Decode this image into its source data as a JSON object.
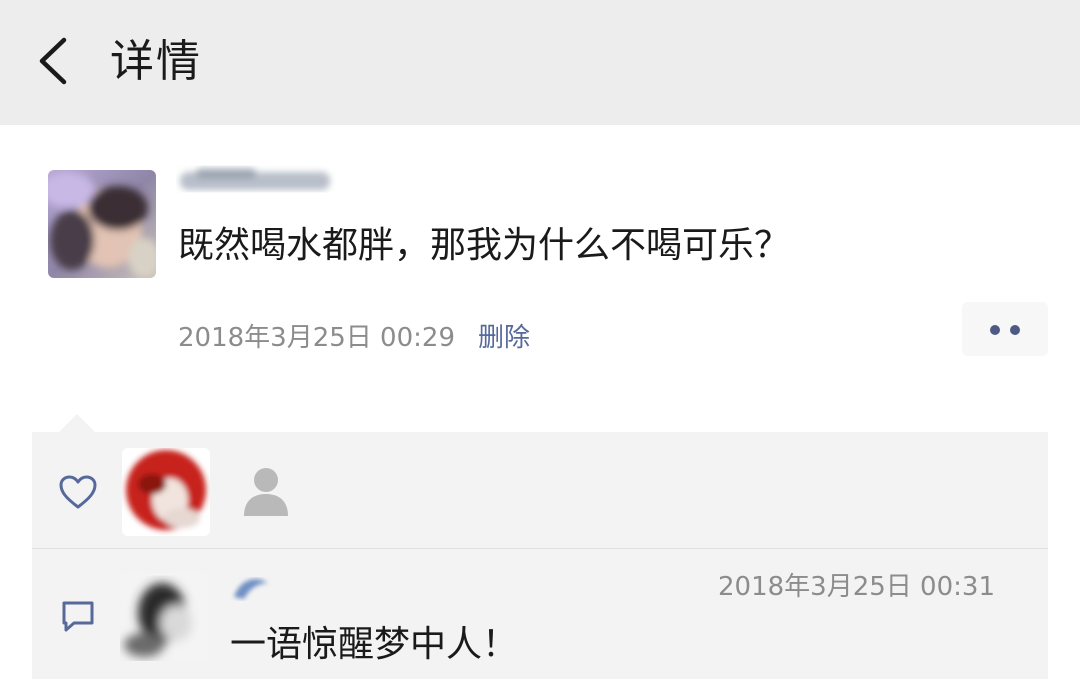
{
  "header": {
    "title": "详情",
    "back_icon": "chevron-left-icon",
    "background": "#ededed"
  },
  "post": {
    "author_name_blurred": true,
    "text": "既然喝水都胖，那我为什么不喝可乐？",
    "timestamp": "2018年3月25日 00:29",
    "delete_label": "删除",
    "more_icon": "more-dots-icon"
  },
  "interactions": {
    "like_icon": "heart-outline-icon",
    "likers": [
      {
        "avatar": "red-avatar",
        "blurred": true
      },
      {
        "avatar": "default-person-icon",
        "blurred": false
      }
    ],
    "comment_icon": "comment-bubble-icon",
    "comments": [
      {
        "author_name_blurred": true,
        "timestamp": "2018年3月25日 00:31",
        "text": "一语惊醒梦中人！"
      }
    ]
  },
  "colors": {
    "link": "#56699a",
    "secondary_text": "#8c8c8c",
    "panel_bg": "#f3f3f3"
  }
}
